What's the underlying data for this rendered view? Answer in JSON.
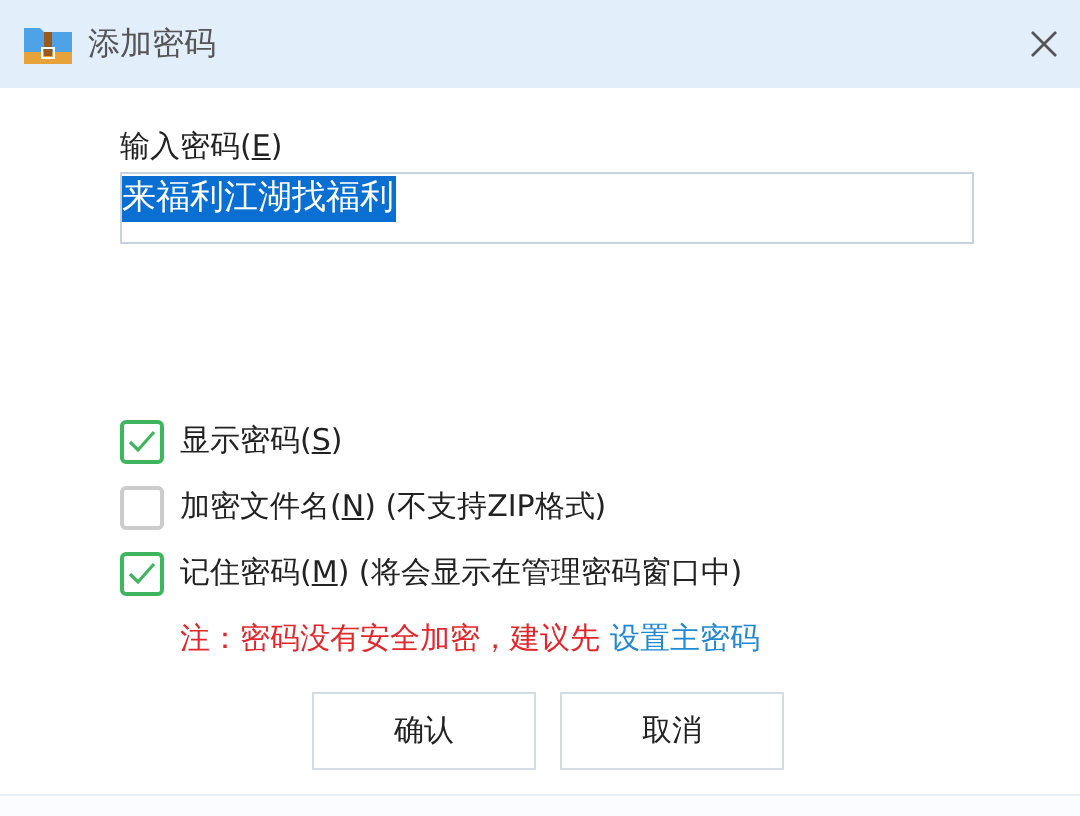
{
  "window": {
    "title": "添加密码"
  },
  "password": {
    "label": {
      "before": "输入密码(",
      "mnemonic": "E",
      "after": ")"
    },
    "value": "来福利江湖找福利",
    "selected": true
  },
  "options": [
    {
      "label": {
        "before": "显示密码(",
        "mnemonic": "S",
        "after": ")"
      },
      "checked": true
    },
    {
      "label": {
        "before": "加密文件名(",
        "mnemonic": "N",
        "after": ") (不支持ZIP格式)"
      },
      "checked": false
    },
    {
      "label": {
        "before": "记住密码(",
        "mnemonic": "M",
        "after": ") (将会显示在管理密码窗口中)"
      },
      "checked": true
    }
  ],
  "note": {
    "text": "注：密码没有安全加密，建议先",
    "link": "设置主密码"
  },
  "buttons": [
    "确认",
    "取消"
  ]
}
